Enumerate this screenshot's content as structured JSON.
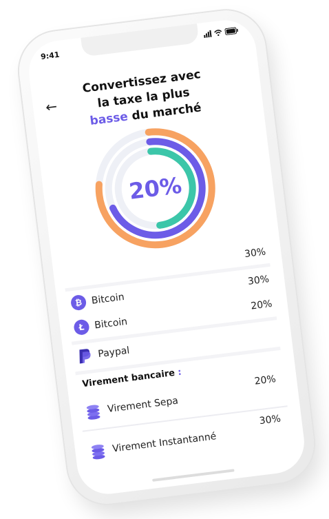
{
  "status_bar": {
    "time": "9:41"
  },
  "header": {
    "line1": "Convertissez avec",
    "line2": "la taxe la plus",
    "accent_word": "basse",
    "line3_rest": " du marché"
  },
  "rate_ring": {
    "label": "20%",
    "colors": {
      "outer": "#f7a261",
      "middle": "#6c5ce7",
      "inner": "#3cc6a9",
      "track": "#eef0f6"
    },
    "fills": {
      "outer": 0.78,
      "middle": 0.7,
      "inner": 0.5
    }
  },
  "crypto": {
    "top_rate": "30%",
    "items": [
      {
        "name": "Bitcoin",
        "rate": "30%",
        "icon": "bitcoin-icon"
      },
      {
        "name": "Bitcoin",
        "rate": "20%",
        "icon": "litecoin-icon"
      },
      {
        "name": "Paypal",
        "rate": "",
        "icon": "paypal-icon"
      }
    ]
  },
  "bank": {
    "title": "Virement bancaire",
    "colon": " :",
    "items": [
      {
        "name": "Virement Sepa",
        "rate": "20%",
        "icon": "coin-stack-icon"
      },
      {
        "name": "Virement Instantanné",
        "rate": "30%",
        "icon": "coin-stack-icon"
      }
    ]
  }
}
